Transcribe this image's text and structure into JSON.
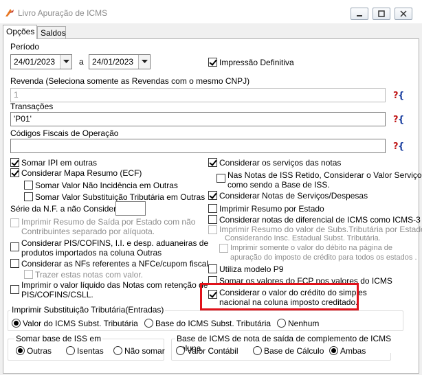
{
  "window": {
    "title": "Livro Apuração de ICMS"
  },
  "tabs": [
    {
      "label": "Opções",
      "active": true
    },
    {
      "label": "Saldos",
      "active": false
    }
  ],
  "periodo": {
    "label": "Período",
    "start": "24/01/2023",
    "sep": "a",
    "end": "24/01/2023"
  },
  "impressao_definitiva": {
    "label": "Impressão Definitiva",
    "checked": true
  },
  "revenda": {
    "label": "Revenda (Seleciona somente as Revendas com o mesmo CNPJ)",
    "value": "1"
  },
  "transacoes": {
    "label": "Transações",
    "value": "'P01'"
  },
  "cfop": {
    "label": "Códigos Fiscais de Operação",
    "value": ""
  },
  "lookup_glyph": "?{",
  "left_options": [
    {
      "label": "Somar  IPI em outras",
      "checked": true
    },
    {
      "label": "Considerar Mapa Resumo (ECF)",
      "checked": true
    },
    {
      "label": "Somar Valor Não Incidência em Outras",
      "checked": false
    },
    {
      "label": "Somar Valor Substituição Tributária em Outras",
      "checked": false
    },
    {
      "label": "Série da N.F. a  não Considerar",
      "value": ""
    },
    {
      "label1": "Imprimir Resumo de Saída por Estado com não",
      "label2": "Contribuintes separado por alíquota.",
      "checked": false,
      "disabled": true
    },
    {
      "label1": "Considerar PIS/COFINS, I.I. e desp. aduaneiras de",
      "label2": "produtos importados na coluna Outras",
      "checked": false
    },
    {
      "label": "Considerar as NFs referentes a NFCe/cupom fiscal",
      "checked": false
    },
    {
      "label": "Trazer estas notas com valor.",
      "checked": false,
      "disabled": true
    },
    {
      "label1": "Imprimir o valor líquido das Notas com retenção de",
      "label2": "PIS/COFINS/CSLL.",
      "checked": false
    }
  ],
  "right_options": [
    {
      "label": "Considerar os serviços das notas",
      "checked": true
    },
    {
      "label1": "Nas Notas de  ISS Retido, Considerar o Valor Serviço",
      "label2": "como sendo a Base de ISS.",
      "checked": false
    },
    {
      "label": "Considerar Notas de Serviços/Despesas",
      "checked": true
    },
    {
      "label": "Imprimir Resumo por Estado",
      "checked": false
    },
    {
      "label": "Considerar notas de diferencial de ICMS como ICMS-3",
      "checked": false
    },
    {
      "label1": "Imprimir Resumo do valor de Subs.Tributária por Estado",
      "label2": "Considerando Insc. Estadual Subst. Tributária.",
      "checked": false,
      "disabled": true
    },
    {
      "label1": "Imprimir somente o valor do débito  na página de",
      "label2": "apuração do imposto de crédito  para todos os estados .",
      "checked": false,
      "disabled": true
    },
    {
      "label": "Utiliza modelo P9",
      "checked": false
    },
    {
      "label": "Somar os valores do FCP  nos valores do ICMS",
      "checked": false
    },
    {
      "label1": "Considerar o valor do crédito do simples",
      "label2": "nacional na coluna imposto creditado.",
      "checked": true
    }
  ],
  "subst_group": {
    "title": "Imprimir Substituição Tributária(Entradas)",
    "options": [
      "Valor do ICMS Subst. Tributária",
      "Base do ICMS Subst. Tributária",
      "Nenhum"
    ],
    "selected": 0
  },
  "iss_group": {
    "title": "Somar base de ISS em",
    "options": [
      "Outras",
      "Isentas",
      "Não somar"
    ],
    "selected": 0
  },
  "icms_group": {
    "title": "Base de ICMS de nota de saída de complemento de ICMS coluna",
    "options": [
      "Valor Contábil",
      "Base de Cálculo",
      "Ambas"
    ],
    "selected": 2
  },
  "colors": {
    "highlight": "#e0121b",
    "accent": "#e87722"
  }
}
